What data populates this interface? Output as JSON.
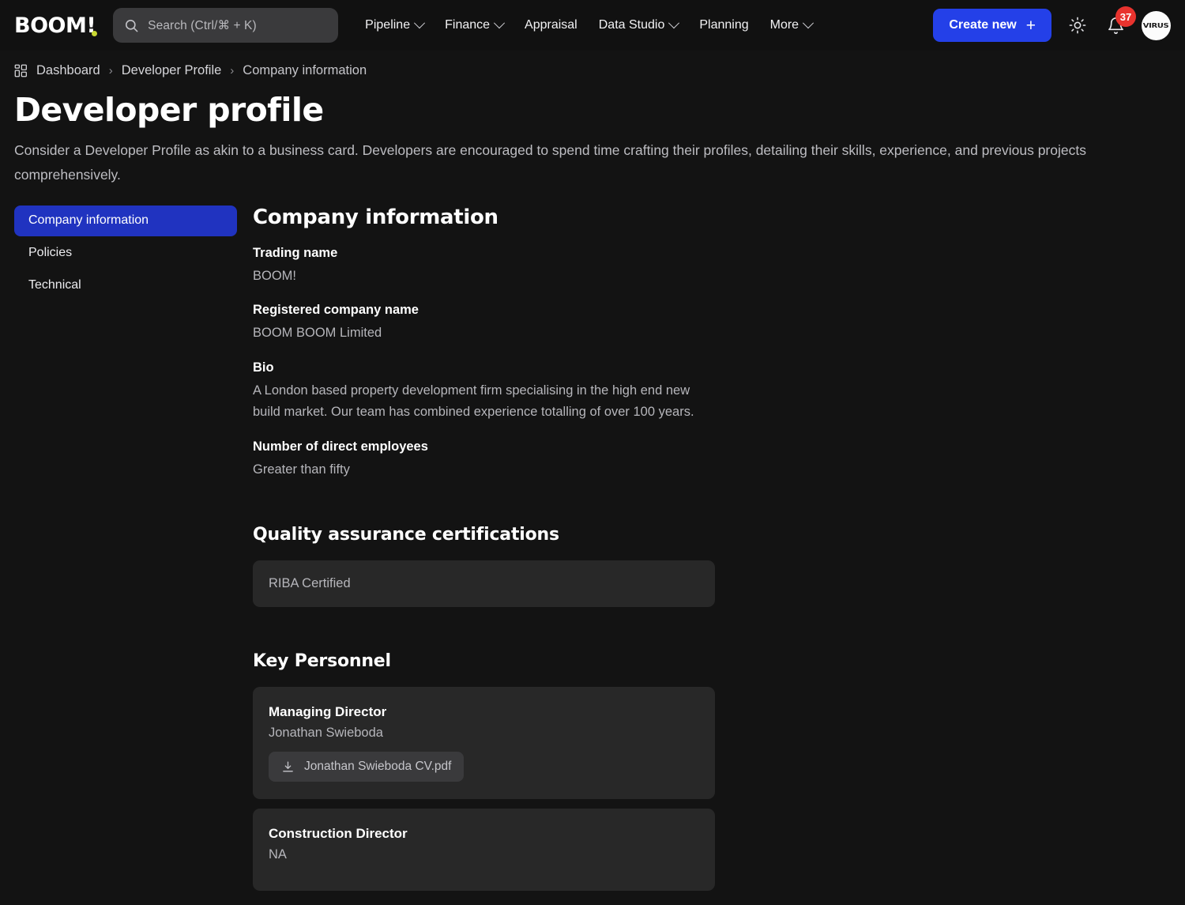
{
  "topbar": {
    "logo": "BOOM!",
    "search": {
      "placeholder": "Search (Ctrl/⌘ + K)",
      "value": ""
    },
    "nav": [
      {
        "label": "Pipeline",
        "has_chevron": true
      },
      {
        "label": "Finance",
        "has_chevron": true
      },
      {
        "label": "Appraisal",
        "has_chevron": false
      },
      {
        "label": "Data Studio",
        "has_chevron": true
      },
      {
        "label": "Planning",
        "has_chevron": false
      },
      {
        "label": "More",
        "has_chevron": true
      }
    ],
    "create_button": "Create new",
    "create_button_glyph": "+",
    "theme_toggle_icon": "sun-icon",
    "notifications": {
      "icon": "bell-icon",
      "count": "37"
    },
    "avatar": {
      "initials": "VIRUS"
    },
    "accent_blue": "#2440e8",
    "badge_red": "#e8332e"
  },
  "breadcrumb": {
    "home_icon": "dashboard-grid-icon",
    "separator": "›",
    "items": [
      {
        "label": "Dashboard"
      },
      {
        "label": "Developer Profile"
      },
      {
        "label": "Company information"
      }
    ]
  },
  "page": {
    "title": "Developer profile",
    "description": "Consider a Developer Profile as akin to a business card. Developers are encouraged to spend time crafting their profiles, detailing their skills, experience, and previous projects comprehensively."
  },
  "sidebar": {
    "items": [
      {
        "label": "Company information",
        "active": true
      },
      {
        "label": "Policies",
        "active": false
      },
      {
        "label": "Technical",
        "active": false
      }
    ],
    "active_color": "#2033c0"
  },
  "main": {
    "section_title": "Company information",
    "fields": [
      {
        "label": "Trading name",
        "value": "BOOM!"
      },
      {
        "label": "Registered company name",
        "value": "BOOM BOOM Limited"
      },
      {
        "label": "Bio",
        "value": "A London based property development firm specialising in the high end new build market. Our team has combined experience totalling of over 100 years."
      },
      {
        "label": "Number of direct employees",
        "value": "Greater than fifty"
      }
    ],
    "certifications": {
      "title": "Quality assurance certifications",
      "items": [
        {
          "name": "RIBA Certified"
        }
      ]
    },
    "key_personnel": {
      "title": "Key Personnel",
      "people": [
        {
          "role": "Managing Director",
          "name": "Jonathan Swieboda",
          "attachment": {
            "filename": "Jonathan Swieboda CV.pdf",
            "icon": "download-icon"
          }
        },
        {
          "role": "Construction Director",
          "name": "NA"
        }
      ]
    }
  }
}
